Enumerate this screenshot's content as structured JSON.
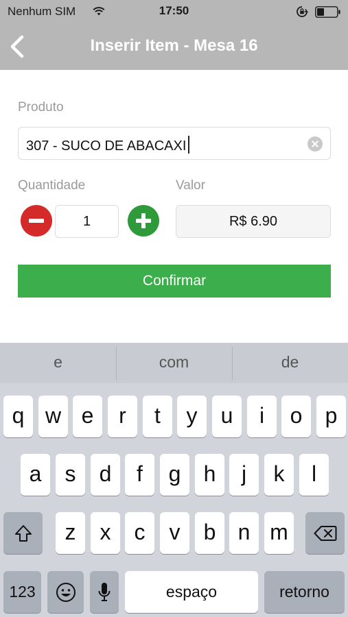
{
  "status_bar": {
    "carrier": "Nenhum SIM",
    "time": "17:50",
    "icons": [
      "wifi-icon",
      "orientation-lock-icon",
      "battery-icon"
    ]
  },
  "nav_bar": {
    "title": "Inserir Item - Mesa 16",
    "back_icon": "chevron-left-icon"
  },
  "form": {
    "produto_label": "Produto",
    "produto_value": "307 - SUCO DE ABACAXI",
    "quantidade_label": "Quantidade",
    "quantidade_value": "1",
    "valor_label": "Valor",
    "valor_value": "R$ 6.90",
    "confirm_label": "Confirmar"
  },
  "keyboard": {
    "suggestions": [
      "e",
      "com",
      "de"
    ],
    "row1": [
      "q",
      "w",
      "e",
      "r",
      "t",
      "y",
      "u",
      "i",
      "o",
      "p"
    ],
    "row2": [
      "a",
      "s",
      "d",
      "f",
      "g",
      "h",
      "j",
      "k",
      "l"
    ],
    "row3": [
      "z",
      "x",
      "c",
      "v",
      "b",
      "n",
      "m"
    ],
    "numbers_key": "123",
    "space_key": "espaço",
    "return_key": "retorno"
  },
  "colors": {
    "bar_gray": "#b7b7b7",
    "minus_red": "#d52a2a",
    "plus_green": "#2f9a3a",
    "confirm_green": "#3dae4c",
    "label_gray": "#9a9a9a"
  }
}
